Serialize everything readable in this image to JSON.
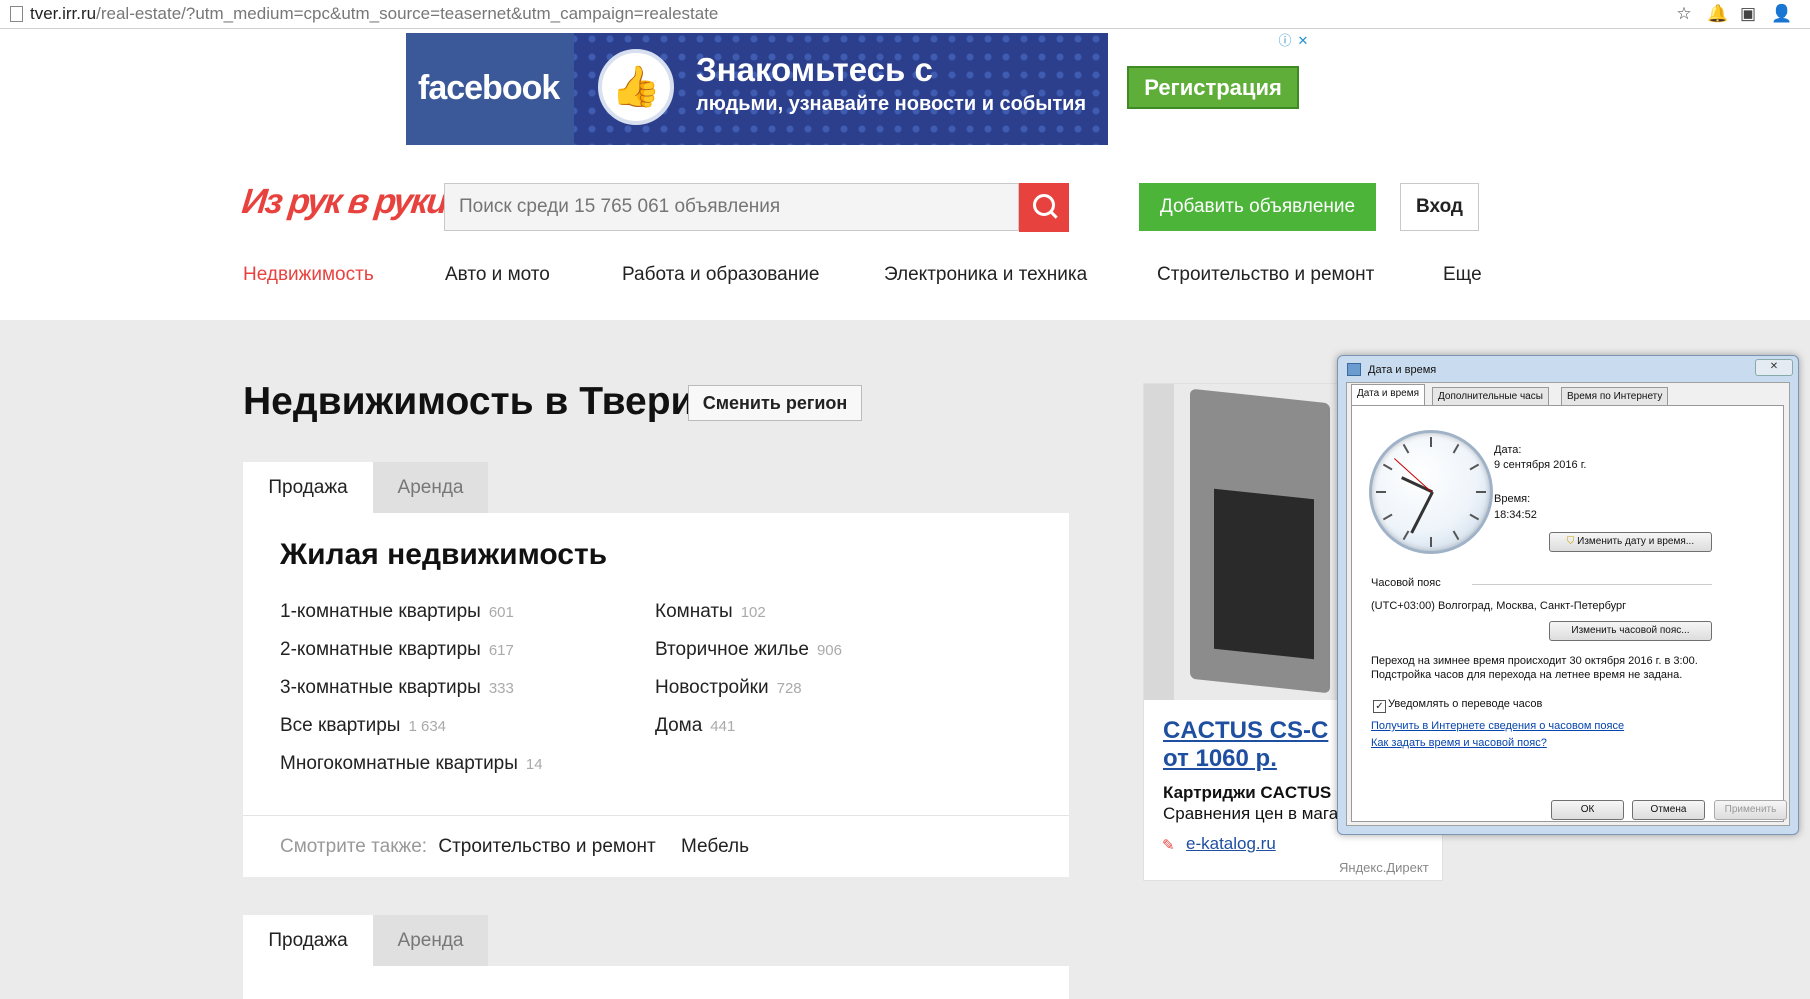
{
  "browser": {
    "url_host": "tver.irr.ru",
    "url_path": "/real-estate/?utm_medium=cpc&utm_source=teasernet&utm_campaign=realestate"
  },
  "banner": {
    "brand": "facebook",
    "headline": "Знакомьтесь с",
    "subline": "людьми, узнавайте новости и события",
    "cta": "Регистрация"
  },
  "header": {
    "logo": "Из рук в руки",
    "search_placeholder": "Поиск среди 15 765 061 объявления",
    "add_button": "Добавить объявление",
    "login_button": "Вход"
  },
  "nav": [
    {
      "label": "Недвижимость"
    },
    {
      "label": "Авто и мото"
    },
    {
      "label": "Работа и образование"
    },
    {
      "label": "Электроника и техника"
    },
    {
      "label": "Строительство и ремонт"
    },
    {
      "label": "Еще"
    }
  ],
  "main": {
    "title": "Недвижимость в Твери",
    "change_region": "Сменить регион",
    "tabs": [
      {
        "label": "Продажа"
      },
      {
        "label": "Аренда"
      }
    ],
    "section_title": "Жилая недвижимость",
    "col1": [
      {
        "label": "1-комнатные квартиры",
        "count": "601"
      },
      {
        "label": "2-комнатные квартиры",
        "count": "617"
      },
      {
        "label": "3-комнатные квартиры",
        "count": "333"
      },
      {
        "label": "Все квартиры",
        "count": "1 634"
      },
      {
        "label": "Многокомнатные квартиры",
        "count": "14"
      }
    ],
    "col2": [
      {
        "label": "Комнаты",
        "count": "102"
      },
      {
        "label": "Вторичное жилье",
        "count": "906"
      },
      {
        "label": "Новостройки",
        "count": "728"
      },
      {
        "label": "Дома",
        "count": "441"
      }
    ],
    "see_also_label": "Смотрите также:",
    "see_also": [
      {
        "label": "Строительство и ремонт"
      },
      {
        "label": "Мебель"
      }
    ],
    "tabs2": [
      {
        "label": "Продажа"
      },
      {
        "label": "Аренда"
      }
    ]
  },
  "ad": {
    "title_line1": "CACTUS CS-C",
    "title_line2": "от 1060 р.",
    "subtitle1": "Картриджи CACTUS",
    "subtitle2": "Сравнения цен в мага",
    "domain": "e-katalog.ru",
    "provider": "Яндекс.Директ"
  },
  "dialog": {
    "title": "Дата и время",
    "close": "✕",
    "tabs": [
      {
        "label": "Дата и время"
      },
      {
        "label": "Дополнительные часы"
      },
      {
        "label": "Время по Интернету"
      }
    ],
    "date_label": "Дата:",
    "date_value": "9 сентября 2016 г.",
    "time_label": "Время:",
    "time_value": "18:34:52",
    "change_datetime": "Изменить дату и время...",
    "tz_label": "Часовой пояс",
    "tz_value": "(UTC+03:00) Волгоград, Москва, Санкт-Петербург",
    "change_tz": "Изменить часовой пояс...",
    "dst_line1": "Переход на зимнее время происходит 30 октября 2016 г. в 3:00.",
    "dst_line2": "Подстройка часов для перехода на летнее время не задана.",
    "notify_label": "Уведомлять о переводе часов",
    "link1": "Получить в Интернете сведения о часовом поясе",
    "link2": "Как задать время и часовой пояс?",
    "ok": "ОК",
    "cancel": "Отмена",
    "apply": "Применить"
  }
}
